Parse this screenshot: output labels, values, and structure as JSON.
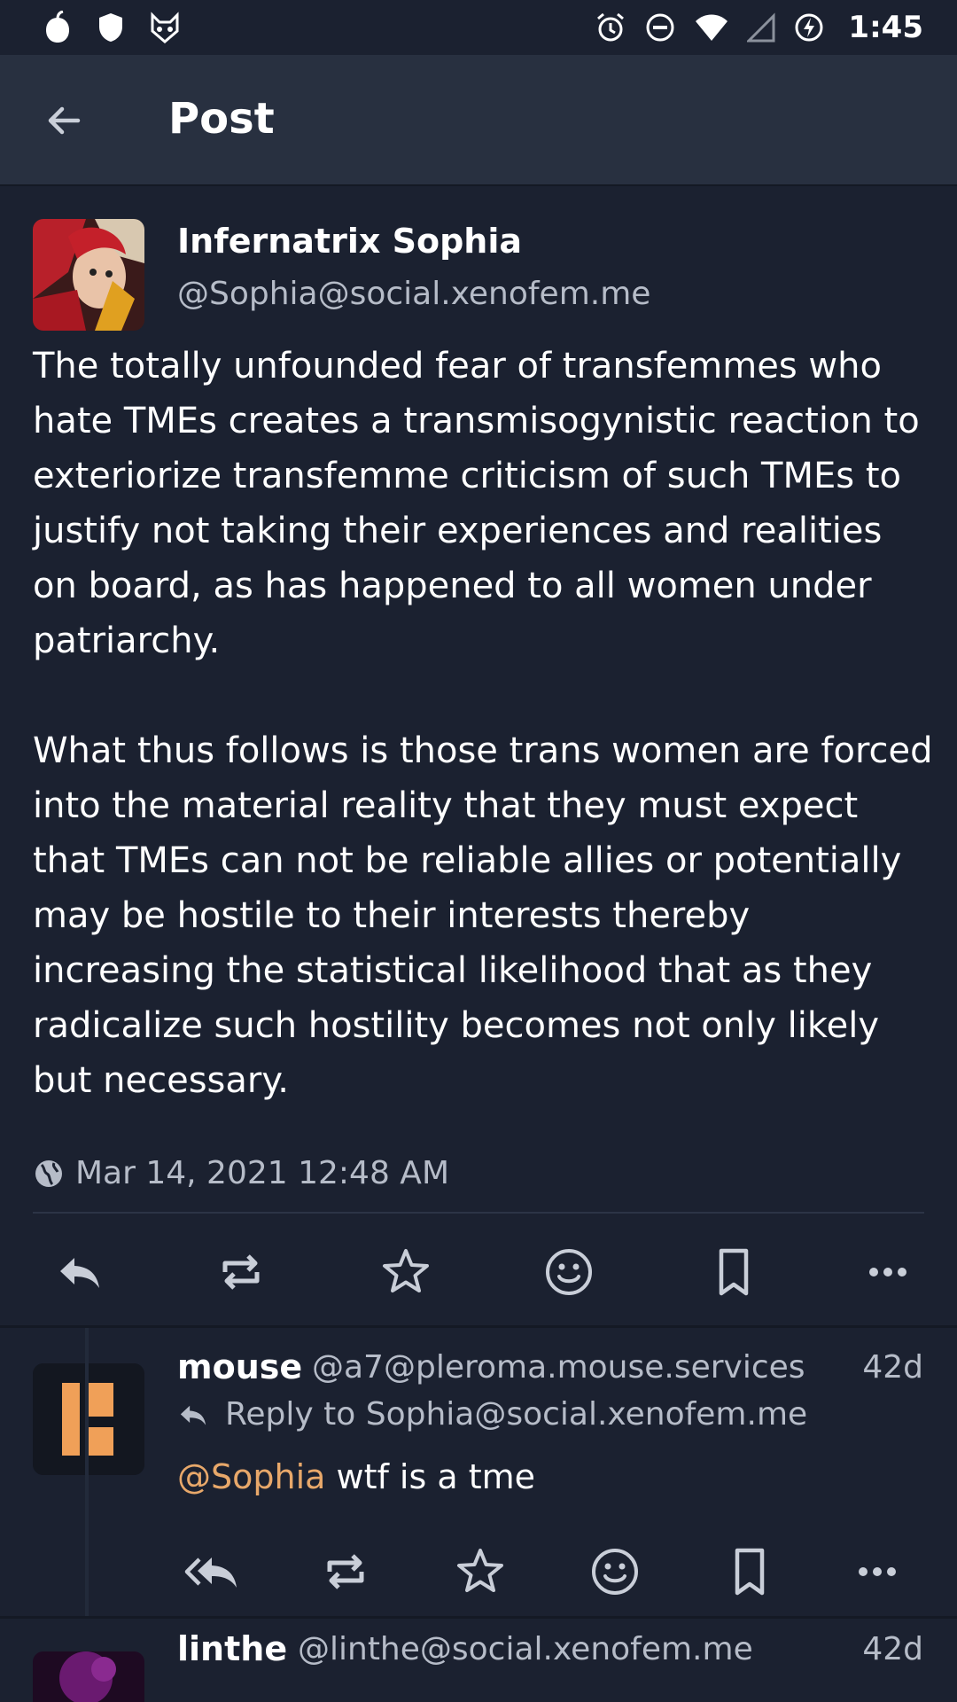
{
  "status_bar": {
    "time": "1:45",
    "left_icons": [
      "apple-like-icon",
      "shield-icon",
      "fox-mask-icon"
    ],
    "right_icons": [
      "alarm-icon",
      "dnd-icon",
      "wifi-icon",
      "signal-icon",
      "battery-charging-icon"
    ]
  },
  "appbar": {
    "title": "Post"
  },
  "post": {
    "author_name": "Infernatrix Sophia",
    "author_handle": "@Sophia@social.xenofem.me",
    "body": "The totally unfounded fear of transfemmes who hate TMEs creates a transmisogynistic reaction to exteriorize transfemme criticism of such TMEs to justify not taking their experiences and realities on board, as has happened to all women under patriarchy.\n\nWhat thus follows is those trans women are forced into the material reality that they must expect that TMEs can not be reliable allies or potentially may be hostile to their interests thereby increasing the statistical likelihood that as they radicalize such hostility becomes not only likely but necessary.",
    "timestamp": "Mar 14, 2021 12:48 AM",
    "visibility_icon": "globe-icon"
  },
  "reply1": {
    "name": "mouse",
    "handle": "@a7@pleroma.mouse.services",
    "time": "42d",
    "reply_to": "Reply to Sophia@social.xenofem.me",
    "mention": "@Sophia",
    "text": " wtf is a tme"
  },
  "reply2": {
    "name": "linthe",
    "handle": "@linthe@social.xenofem.me",
    "time": "42d"
  },
  "colors": {
    "background": "#1b2130",
    "appbar": "#283040",
    "muted_text": "#b6bcc8",
    "mention": "#e8a86a",
    "icon": "#c9ced8"
  }
}
